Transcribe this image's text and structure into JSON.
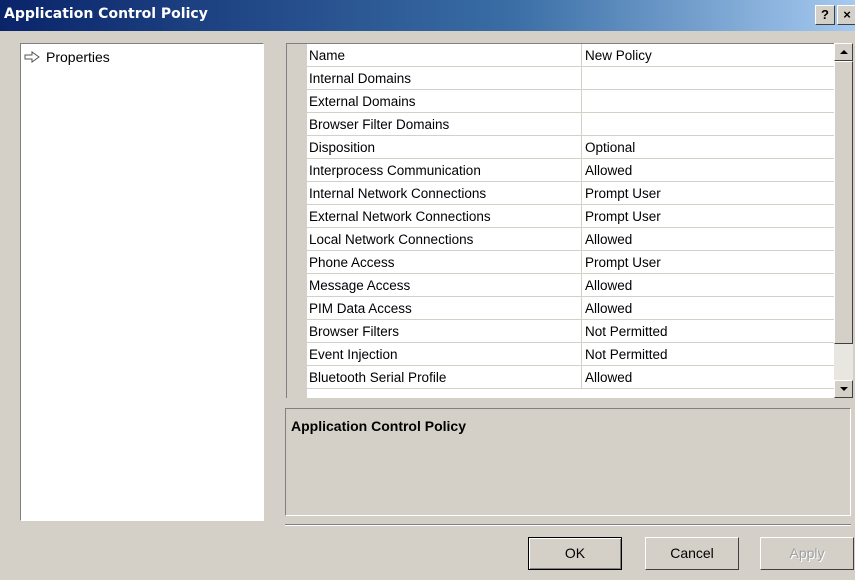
{
  "window": {
    "title": "Application Control Policy",
    "help_glyph": "?",
    "close_glyph": "×"
  },
  "tree": {
    "items": [
      {
        "label": "Properties",
        "icon": "arrow-right-icon"
      }
    ]
  },
  "grid": {
    "rows": [
      {
        "name": "Name",
        "value": "New Policy"
      },
      {
        "name": "Internal Domains",
        "value": ""
      },
      {
        "name": "External Domains",
        "value": ""
      },
      {
        "name": "Browser Filter Domains",
        "value": ""
      },
      {
        "name": "Disposition",
        "value": "Optional"
      },
      {
        "name": "Interprocess Communication",
        "value": "Allowed"
      },
      {
        "name": "Internal Network Connections",
        "value": "Prompt User"
      },
      {
        "name": "External Network Connections",
        "value": "Prompt User"
      },
      {
        "name": "Local Network Connections",
        "value": "Allowed"
      },
      {
        "name": "Phone Access",
        "value": "Prompt User"
      },
      {
        "name": "Message Access",
        "value": "Allowed"
      },
      {
        "name": "PIM Data Access",
        "value": "Allowed"
      },
      {
        "name": "Browser Filters",
        "value": "Not Permitted"
      },
      {
        "name": "Event Injection",
        "value": "Not Permitted"
      },
      {
        "name": "Bluetooth Serial Profile",
        "value": "Allowed"
      }
    ]
  },
  "description": {
    "title": "Application Control Policy"
  },
  "buttons": {
    "ok": "OK",
    "cancel": "Cancel",
    "apply": "Apply"
  }
}
